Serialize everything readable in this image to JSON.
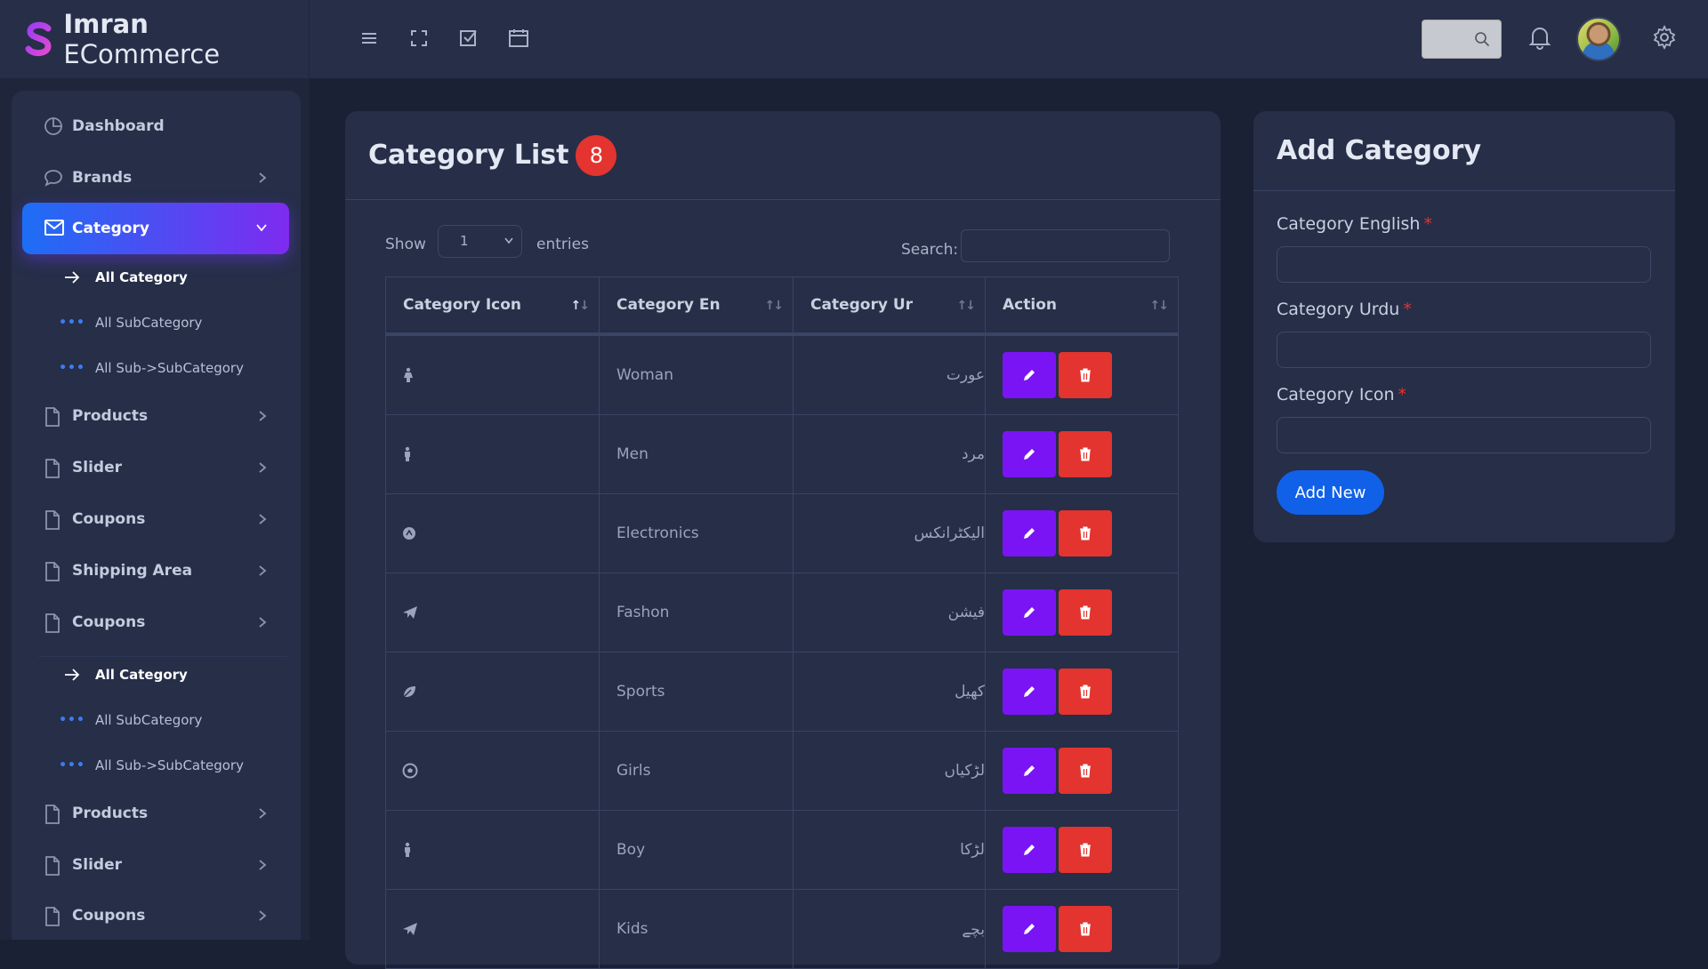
{
  "brand": {
    "name_bold": "Imran",
    "name_rest": " ECommerce"
  },
  "header": {
    "icons": [
      "menu-icon",
      "fullscreen-icon",
      "checkbox-icon",
      "calendar-icon"
    ]
  },
  "sidebar": {
    "items": [
      {
        "label": "Dashboard"
      },
      {
        "label": "Brands"
      },
      {
        "label": "Category"
      },
      {
        "label": "All Category"
      },
      {
        "label": "All SubCategory"
      },
      {
        "label": "All Sub->SubCategory"
      },
      {
        "label": "Products"
      },
      {
        "label": "Slider"
      },
      {
        "label": "Coupons"
      },
      {
        "label": "Shipping Area"
      },
      {
        "label": "Coupons"
      },
      {
        "label": "All Category"
      },
      {
        "label": "All SubCategory"
      },
      {
        "label": "All Sub->SubCategory"
      },
      {
        "label": "Products"
      },
      {
        "label": "Slider"
      },
      {
        "label": "Coupons"
      }
    ]
  },
  "list": {
    "title": "Category List",
    "count": "8",
    "show_label": "Show",
    "entries_value": "1",
    "entries_label": "entries",
    "search_label": "Search:",
    "columns": [
      "Category Icon",
      "Category En",
      "Category Ur",
      "Action"
    ],
    "rows": [
      {
        "icon": "female-icon",
        "en": "Woman",
        "ur": "عورت"
      },
      {
        "icon": "male-icon",
        "en": "Men",
        "ur": "مرد"
      },
      {
        "icon": "circle-icon",
        "en": "Electronics",
        "ur": "الیکٹرانکس"
      },
      {
        "icon": "paper-plane-icon",
        "en": "Fashon",
        "ur": "فیشن"
      },
      {
        "icon": "leaf-icon",
        "en": "Sports",
        "ur": "کھیل"
      },
      {
        "icon": "soccer-ball-icon",
        "en": "Girls",
        "ur": "لڑکیاں"
      },
      {
        "icon": "male-icon",
        "en": "Boy",
        "ur": "لڑکا"
      },
      {
        "icon": "paper-plane-icon",
        "en": "Kids",
        "ur": "بچے"
      }
    ]
  },
  "add": {
    "title": "Add Category",
    "label_en": "Category English",
    "label_ur": "Category Urdu",
    "label_icon": "Category Icon",
    "required_mark": "*",
    "button": "Add New"
  },
  "colors": {
    "accent": "#7a14f4",
    "danger": "#e3342f",
    "primary": "#1061e8",
    "card": "#262e48",
    "background": "#1b2135"
  }
}
